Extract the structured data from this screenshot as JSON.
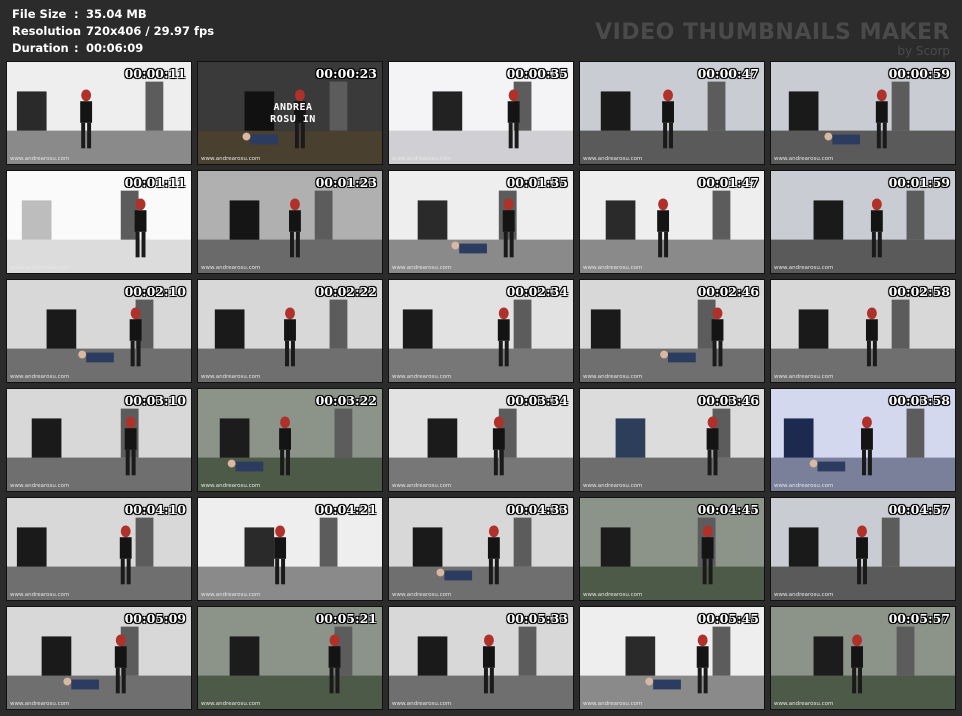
{
  "info": {
    "file_size_label": "File Size",
    "file_size_value": "35.04 MB",
    "resolution_label": "Resolution",
    "resolution_value": "720x406 / 29.97 fps",
    "duration_label": "Duration",
    "duration_value": "00:06:09",
    "separator": ":"
  },
  "brand": {
    "title": "VIDEO THUMBNAILS MAKER",
    "subtitle": "by Scorp"
  },
  "watermark": "www.andrearosu.com",
  "caption_text": "ANDREA ROSU IN",
  "colors": {
    "background": "#2b2b2b",
    "brand": "#4a4a4a",
    "timestamp": "#ffffff"
  },
  "thumbnails": [
    {
      "time": "00:00:11",
      "scene": "hall"
    },
    {
      "time": "00:00:23",
      "scene": "caption"
    },
    {
      "time": "00:00:35",
      "scene": "suitcase"
    },
    {
      "time": "00:00:47",
      "scene": "window"
    },
    {
      "time": "00:00:59",
      "scene": "window"
    },
    {
      "time": "00:01:11",
      "scene": "suitcase-light"
    },
    {
      "time": "00:01:23",
      "scene": "closeup"
    },
    {
      "time": "00:01:35",
      "scene": "hall"
    },
    {
      "time": "00:01:47",
      "scene": "hall"
    },
    {
      "time": "00:01:59",
      "scene": "window"
    },
    {
      "time": "00:02:10",
      "scene": "room"
    },
    {
      "time": "00:02:22",
      "scene": "room"
    },
    {
      "time": "00:02:34",
      "scene": "desk"
    },
    {
      "time": "00:02:46",
      "scene": "room"
    },
    {
      "time": "00:02:58",
      "scene": "room"
    },
    {
      "time": "00:03:10",
      "scene": "room"
    },
    {
      "time": "00:03:22",
      "scene": "sofa"
    },
    {
      "time": "00:03:34",
      "scene": "desk"
    },
    {
      "time": "00:03:46",
      "scene": "floor"
    },
    {
      "time": "00:03:58",
      "scene": "blue"
    },
    {
      "time": "00:04:10",
      "scene": "room"
    },
    {
      "time": "00:04:21",
      "scene": "hall"
    },
    {
      "time": "00:04:33",
      "scene": "room"
    },
    {
      "time": "00:04:45",
      "scene": "sofa"
    },
    {
      "time": "00:04:57",
      "scene": "window"
    },
    {
      "time": "00:05:09",
      "scene": "room"
    },
    {
      "time": "00:05:21",
      "scene": "sofa"
    },
    {
      "time": "00:05:33",
      "scene": "room"
    },
    {
      "time": "00:05:45",
      "scene": "hall"
    },
    {
      "time": "00:05:57",
      "scene": "sofa"
    }
  ]
}
